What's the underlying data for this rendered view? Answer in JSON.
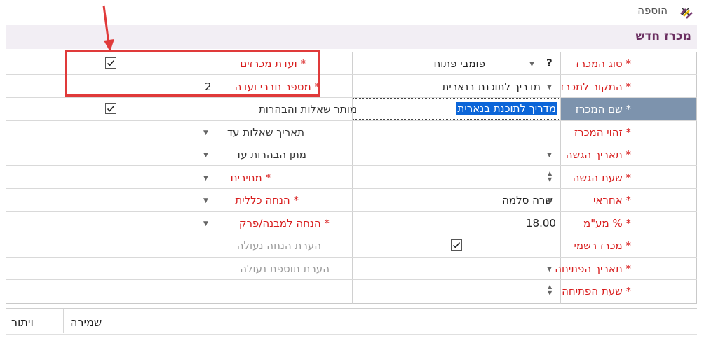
{
  "window": {
    "title": "הוספה",
    "close_label": "×"
  },
  "form": {
    "title": "מכרז חדש"
  },
  "right_fields": [
    {
      "label": "* סוג המכרז",
      "value": "פומבי פתוח",
      "extra": "?"
    },
    {
      "label": "* המקור למכרז",
      "value": "מדריך לתוכנת בנארית"
    },
    {
      "label": "* שם המכרז",
      "value": "מדריך לתוכנת בנארית"
    },
    {
      "label": "* זהוי המכרז",
      "value": ""
    },
    {
      "label": "* תאריך הגשה",
      "value": ""
    },
    {
      "label": "* שעת הגשה",
      "value": ""
    },
    {
      "label": "* אחראי",
      "value": "שרה סלמה"
    },
    {
      "label": "* % מע\"מ",
      "value": "18.00"
    },
    {
      "label": "* מכרז רשמי",
      "value": true
    },
    {
      "label": "* תאריך הפתיחה",
      "value": ""
    },
    {
      "label": "* שעת הפתיחה",
      "value": ""
    }
  ],
  "left_fields": [
    {
      "label": "* ועדת מכרזים",
      "value": true
    },
    {
      "label": "* מספר חברי ועדה",
      "value": "2"
    },
    {
      "label": "מותר שאלות והבהרות",
      "value": true
    },
    {
      "label": "תאריך שאלות עד",
      "value": ""
    },
    {
      "label": "מתן הבהרות עד",
      "value": ""
    },
    {
      "label": "* מחירים",
      "value": ""
    },
    {
      "label": "* הנחה כללית",
      "value": ""
    },
    {
      "label": "* הנחה למבנה/פרק",
      "value": ""
    },
    {
      "label": "הערת הנחה נעולה",
      "value": ""
    },
    {
      "label": "הערת תוספת נעולה",
      "value": ""
    }
  ],
  "footer": {
    "cancel_label": "ויתור",
    "save_label": "שמירה"
  },
  "colors": {
    "accent": "#6b2f61",
    "required": "#d81e1e",
    "annotation": "#e03a3a",
    "selection": "#0b65d8"
  }
}
